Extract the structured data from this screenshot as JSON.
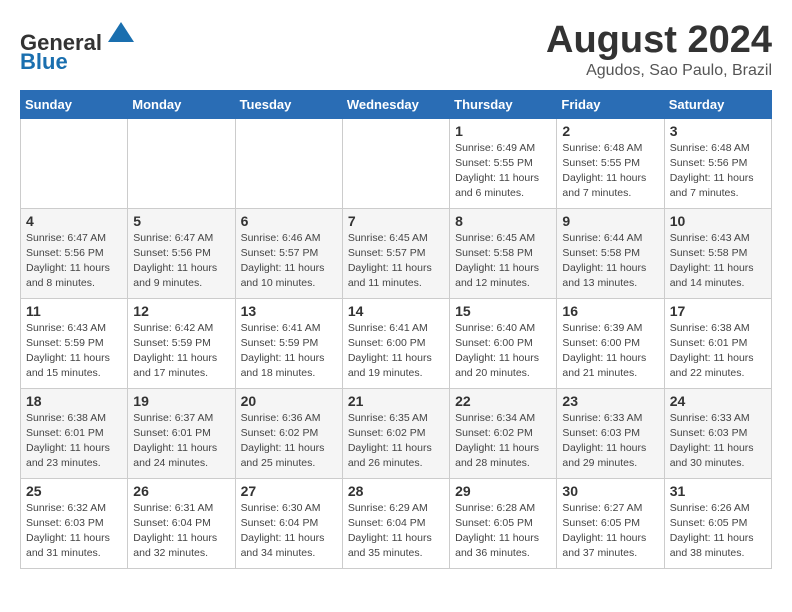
{
  "header": {
    "logo_line1": "General",
    "logo_line2": "Blue",
    "month_year": "August 2024",
    "location": "Agudos, Sao Paulo, Brazil"
  },
  "weekdays": [
    "Sunday",
    "Monday",
    "Tuesday",
    "Wednesday",
    "Thursday",
    "Friday",
    "Saturday"
  ],
  "weeks": [
    [
      {
        "day": "",
        "detail": ""
      },
      {
        "day": "",
        "detail": ""
      },
      {
        "day": "",
        "detail": ""
      },
      {
        "day": "",
        "detail": ""
      },
      {
        "day": "1",
        "detail": "Sunrise: 6:49 AM\nSunset: 5:55 PM\nDaylight: 11 hours\nand 6 minutes."
      },
      {
        "day": "2",
        "detail": "Sunrise: 6:48 AM\nSunset: 5:55 PM\nDaylight: 11 hours\nand 7 minutes."
      },
      {
        "day": "3",
        "detail": "Sunrise: 6:48 AM\nSunset: 5:56 PM\nDaylight: 11 hours\nand 7 minutes."
      }
    ],
    [
      {
        "day": "4",
        "detail": "Sunrise: 6:47 AM\nSunset: 5:56 PM\nDaylight: 11 hours\nand 8 minutes."
      },
      {
        "day": "5",
        "detail": "Sunrise: 6:47 AM\nSunset: 5:56 PM\nDaylight: 11 hours\nand 9 minutes."
      },
      {
        "day": "6",
        "detail": "Sunrise: 6:46 AM\nSunset: 5:57 PM\nDaylight: 11 hours\nand 10 minutes."
      },
      {
        "day": "7",
        "detail": "Sunrise: 6:45 AM\nSunset: 5:57 PM\nDaylight: 11 hours\nand 11 minutes."
      },
      {
        "day": "8",
        "detail": "Sunrise: 6:45 AM\nSunset: 5:58 PM\nDaylight: 11 hours\nand 12 minutes."
      },
      {
        "day": "9",
        "detail": "Sunrise: 6:44 AM\nSunset: 5:58 PM\nDaylight: 11 hours\nand 13 minutes."
      },
      {
        "day": "10",
        "detail": "Sunrise: 6:43 AM\nSunset: 5:58 PM\nDaylight: 11 hours\nand 14 minutes."
      }
    ],
    [
      {
        "day": "11",
        "detail": "Sunrise: 6:43 AM\nSunset: 5:59 PM\nDaylight: 11 hours\nand 15 minutes."
      },
      {
        "day": "12",
        "detail": "Sunrise: 6:42 AM\nSunset: 5:59 PM\nDaylight: 11 hours\nand 17 minutes."
      },
      {
        "day": "13",
        "detail": "Sunrise: 6:41 AM\nSunset: 5:59 PM\nDaylight: 11 hours\nand 18 minutes."
      },
      {
        "day": "14",
        "detail": "Sunrise: 6:41 AM\nSunset: 6:00 PM\nDaylight: 11 hours\nand 19 minutes."
      },
      {
        "day": "15",
        "detail": "Sunrise: 6:40 AM\nSunset: 6:00 PM\nDaylight: 11 hours\nand 20 minutes."
      },
      {
        "day": "16",
        "detail": "Sunrise: 6:39 AM\nSunset: 6:00 PM\nDaylight: 11 hours\nand 21 minutes."
      },
      {
        "day": "17",
        "detail": "Sunrise: 6:38 AM\nSunset: 6:01 PM\nDaylight: 11 hours\nand 22 minutes."
      }
    ],
    [
      {
        "day": "18",
        "detail": "Sunrise: 6:38 AM\nSunset: 6:01 PM\nDaylight: 11 hours\nand 23 minutes."
      },
      {
        "day": "19",
        "detail": "Sunrise: 6:37 AM\nSunset: 6:01 PM\nDaylight: 11 hours\nand 24 minutes."
      },
      {
        "day": "20",
        "detail": "Sunrise: 6:36 AM\nSunset: 6:02 PM\nDaylight: 11 hours\nand 25 minutes."
      },
      {
        "day": "21",
        "detail": "Sunrise: 6:35 AM\nSunset: 6:02 PM\nDaylight: 11 hours\nand 26 minutes."
      },
      {
        "day": "22",
        "detail": "Sunrise: 6:34 AM\nSunset: 6:02 PM\nDaylight: 11 hours\nand 28 minutes."
      },
      {
        "day": "23",
        "detail": "Sunrise: 6:33 AM\nSunset: 6:03 PM\nDaylight: 11 hours\nand 29 minutes."
      },
      {
        "day": "24",
        "detail": "Sunrise: 6:33 AM\nSunset: 6:03 PM\nDaylight: 11 hours\nand 30 minutes."
      }
    ],
    [
      {
        "day": "25",
        "detail": "Sunrise: 6:32 AM\nSunset: 6:03 PM\nDaylight: 11 hours\nand 31 minutes."
      },
      {
        "day": "26",
        "detail": "Sunrise: 6:31 AM\nSunset: 6:04 PM\nDaylight: 11 hours\nand 32 minutes."
      },
      {
        "day": "27",
        "detail": "Sunrise: 6:30 AM\nSunset: 6:04 PM\nDaylight: 11 hours\nand 34 minutes."
      },
      {
        "day": "28",
        "detail": "Sunrise: 6:29 AM\nSunset: 6:04 PM\nDaylight: 11 hours\nand 35 minutes."
      },
      {
        "day": "29",
        "detail": "Sunrise: 6:28 AM\nSunset: 6:05 PM\nDaylight: 11 hours\nand 36 minutes."
      },
      {
        "day": "30",
        "detail": "Sunrise: 6:27 AM\nSunset: 6:05 PM\nDaylight: 11 hours\nand 37 minutes."
      },
      {
        "day": "31",
        "detail": "Sunrise: 6:26 AM\nSunset: 6:05 PM\nDaylight: 11 hours\nand 38 minutes."
      }
    ]
  ]
}
